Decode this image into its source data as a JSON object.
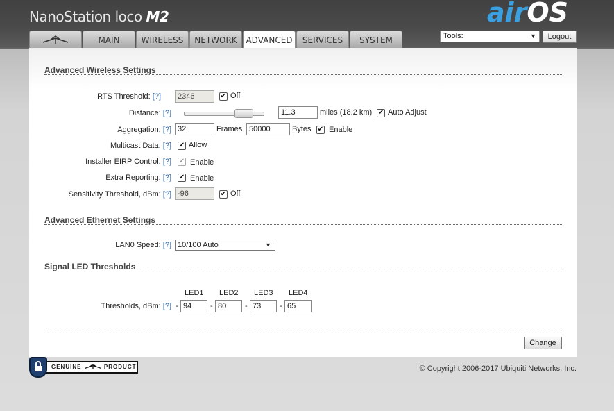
{
  "header": {
    "product_name": "NanoStation loco",
    "product_model": "M2",
    "logo_air": "air",
    "logo_os": "OS",
    "logo_tm": "™"
  },
  "tabs": [
    {
      "label": "",
      "icon": "ubiquiti-logo-icon"
    },
    {
      "label": "MAIN"
    },
    {
      "label": "WIRELESS"
    },
    {
      "label": "NETWORK"
    },
    {
      "label": "ADVANCED",
      "active": true
    },
    {
      "label": "SERVICES"
    },
    {
      "label": "SYSTEM"
    }
  ],
  "tools": {
    "value": "Tools:",
    "logout_label": "Logout"
  },
  "advanced_wireless": {
    "title": "Advanced Wireless Settings",
    "help": "[?]",
    "rts_label": "RTS Threshold:",
    "rts_value": "2346",
    "rts_off": "Off",
    "distance_label": "Distance:",
    "distance_value": "11.3",
    "distance_units": "miles (18.2 km)",
    "auto_adjust": "Auto Adjust",
    "aggregation_label": "Aggregation:",
    "aggregation_frames": "32",
    "frames_label": "Frames",
    "aggregation_bytes": "50000",
    "bytes_label": "Bytes",
    "enable": "Enable",
    "multicast_label": "Multicast Data:",
    "allow": "Allow",
    "installer_label": "Installer EIRP Control:",
    "extra_label": "Extra Reporting:",
    "sensitivity_label": "Sensitivity Threshold, dBm:",
    "sensitivity_value": "-96",
    "sensitivity_off": "Off"
  },
  "advanced_ethernet": {
    "title": "Advanced Ethernet Settings",
    "lan0_label": "LAN0 Speed:",
    "lan0_value": "10/100 Auto"
  },
  "signal_led": {
    "title": "Signal LED Thresholds",
    "headers": [
      "LED1",
      "LED2",
      "LED3",
      "LED4"
    ],
    "thresholds_label": "Thresholds, dBm:",
    "dash": "-",
    "values": [
      "94",
      "80",
      "73",
      "65"
    ]
  },
  "footer": {
    "change_label": "Change",
    "genuine_text": "GENUINE",
    "product_text": "PRODUCT",
    "copyright": "© Copyright 2006-2017 Ubiquiti Networks, Inc."
  }
}
